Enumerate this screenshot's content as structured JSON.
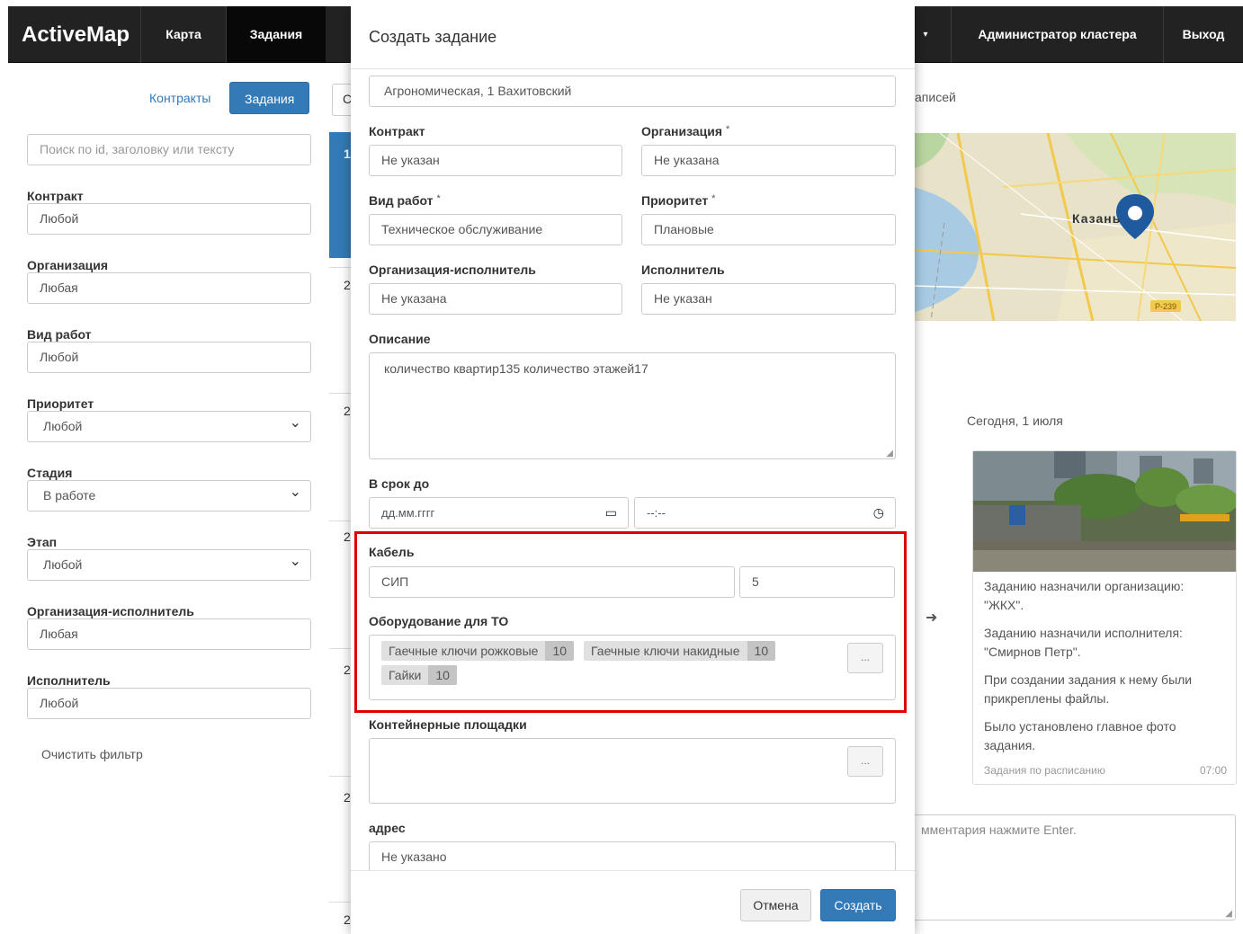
{
  "navbar": {
    "brand": "ActiveMap",
    "items": [
      "Карта",
      "Задания"
    ],
    "admin": "Администратор кластера",
    "logout": "Выход"
  },
  "sidebar": {
    "tab_contracts": "Контракты",
    "tab_tasks": "Задания",
    "search_placeholder": "Поиск по id, заголовку или тексту",
    "filters": [
      {
        "label": "Контракт",
        "value": "Любой"
      },
      {
        "label": "Организация",
        "value": "Любая"
      },
      {
        "label": "Вид работ",
        "value": "Любой"
      },
      {
        "label": "Приоритет",
        "value": "Любой"
      },
      {
        "label": "Стадия",
        "value": "В работе"
      },
      {
        "label": "Этап",
        "value": "Любой"
      },
      {
        "label": "Организация-исполнитель",
        "value": "Любая"
      },
      {
        "label": "Исполнитель",
        "value": "Любой"
      }
    ],
    "clear": "Очистить фильтр"
  },
  "list": {
    "nums": [
      "1",
      "2",
      "2",
      "2",
      "2",
      "2",
      "2"
    ],
    "edge_letter": "С"
  },
  "right": {
    "records_suffix": "аписей",
    "map_city": "Казань",
    "map_road": "Р-239",
    "today": "Сегодня, 1 июля",
    "events": [
      "Заданию назначили организацию: \"ЖКХ\".",
      "Заданию назначили исполнителя: \"Смирнов Петр\".",
      "При создании задания к нему были прикреплены файлы.",
      "Было установлено главное фото задания."
    ],
    "footer": "Задания по расписанию",
    "time": "07:00",
    "comment_placeholder": "мментария нажмите Enter."
  },
  "modal": {
    "title": "Создать задание",
    "address_value": "Агрономическая, 1 Вахитовский",
    "contract_label": "Контракт",
    "contract_value": "Не указан",
    "org_label": "Организация",
    "org_value": "Не указана",
    "work_label": "Вид работ",
    "work_value": "Техническое обслуживание",
    "priority_label": "Приоритет",
    "priority_value": "Плановые",
    "exec_org_label": "Организация-исполнитель",
    "exec_org_value": "Не указана",
    "executor_label": "Исполнитель",
    "executor_value": "Не указан",
    "desc_label": "Описание",
    "desc_value": "количество квартир135 количество этажей17",
    "deadline_label": "В срок до",
    "date_placeholder": "дд.мм.гггг",
    "time_placeholder": "--:--",
    "cable_label": "Кабель",
    "cable_value": "СИП",
    "cable_qty": "5",
    "equip_label": "Оборудование для ТО",
    "equip_tags": [
      {
        "name": "Гаечные ключи рожковые",
        "count": "10"
      },
      {
        "name": "Гаечные ключи накидные",
        "count": "10"
      },
      {
        "name": "Гайки",
        "count": "10"
      }
    ],
    "dots": "...",
    "containers_label": "Контейнерные площадки",
    "addr_label": "адрес",
    "addr_value": "Не указано",
    "required_mark": "*",
    "cancel": "Отмена",
    "create": "Создать"
  }
}
